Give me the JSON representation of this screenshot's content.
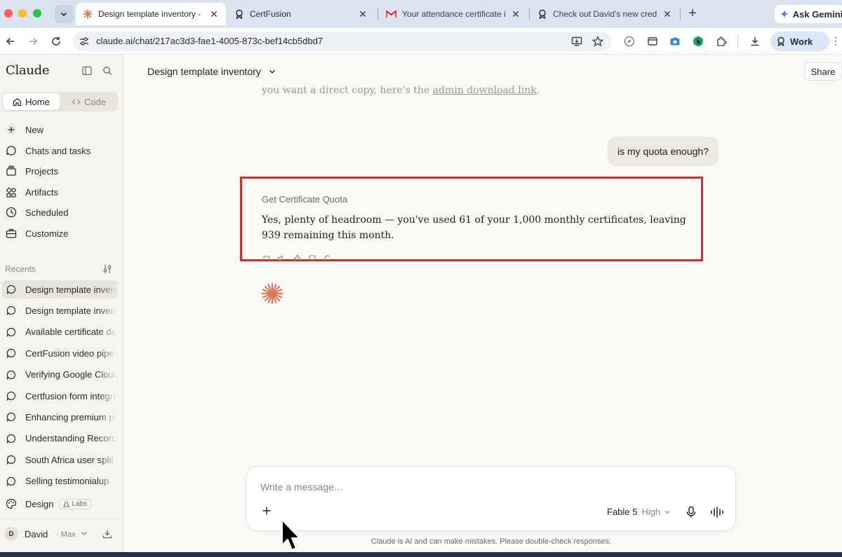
{
  "browser": {
    "tabs": [
      {
        "title": "Design template inventory - C",
        "icon": "claude-spark-icon",
        "active": true
      },
      {
        "title": "CertFusion",
        "icon": "ribbon-icon",
        "active": false
      },
      {
        "title": "Your attendance certificate is",
        "icon": "gmail-icon",
        "active": false
      },
      {
        "title": "Check out David's new crede",
        "icon": "ribbon-icon",
        "active": false
      }
    ],
    "ask_gemini": "Ask Gemini",
    "url": "claude.ai/chat/217ac3d3-fae1-4005-873c-bef14cb5dbd7",
    "profile": "Work"
  },
  "sidebar": {
    "brand": "Claude",
    "modes": {
      "home": "Home",
      "code": "Code"
    },
    "nav": [
      {
        "label": "New",
        "icon": "plus-icon"
      },
      {
        "label": "Chats and tasks",
        "icon": "chat-icon"
      },
      {
        "label": "Projects",
        "icon": "folder-icon"
      },
      {
        "label": "Artifacts",
        "icon": "artifacts-icon"
      },
      {
        "label": "Scheduled",
        "icon": "clock-icon"
      },
      {
        "label": "Customize",
        "icon": "briefcase-icon"
      }
    ],
    "recents_heading": "Recents",
    "recents": [
      "Design template inventory",
      "Design template inventory",
      "Available certificate designs",
      "CertFusion video pipeline",
      "Verifying Google Cloud",
      "Certfusion form integration",
      "Enhancing premium plans",
      "Understanding Records",
      "South Africa user split",
      "Selling testimonialup"
    ],
    "design": {
      "label": "Design",
      "badge": "Labs"
    },
    "user": {
      "initial": "D",
      "name": "David",
      "plan": "· Max"
    }
  },
  "main": {
    "chat_title": "Design template inventory",
    "share": "Share",
    "prev_line": {
      "text": "you want a direct copy, here's the ",
      "link": "admin download link",
      "end": "."
    },
    "user_message": "is my quota enough?",
    "tool_label": "Get Certificate Quota",
    "reply": "Yes, plenty of headroom — you've used 61 of your 1,000 monthly certificates, leaving 939 remaining this month.",
    "composer": {
      "placeholder": "Write a message…",
      "model": "Fable 5",
      "effort": "High"
    },
    "disclaimer": "Claude is AI and can make mistakes. Please double-check responses."
  },
  "colors": {
    "accent": "#d97757",
    "highlight": "#d32f2f",
    "sidebar_bg": "#f5f4ef",
    "main_bg": "#faf9f5"
  }
}
